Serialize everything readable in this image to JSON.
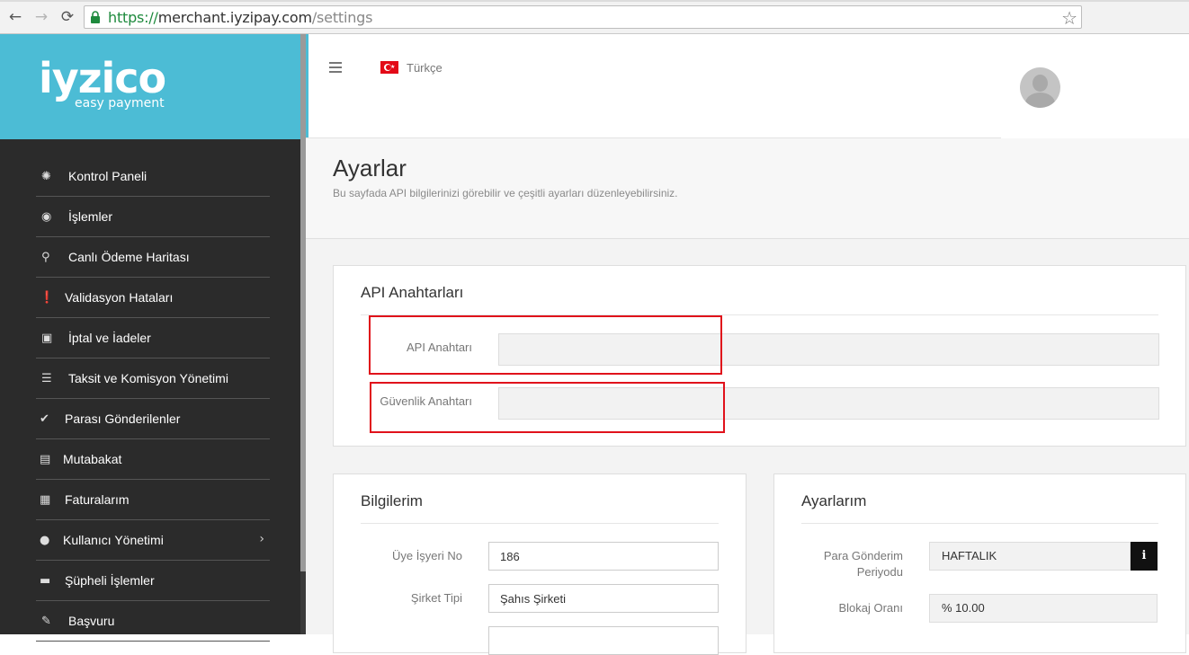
{
  "browser": {
    "url_scheme": "https://",
    "url_host": "merchant.iyzipay.com",
    "url_path": "/settings",
    "back_glyph": "←",
    "forward_glyph": "→",
    "reload_glyph": "⟳",
    "star_glyph": "☆"
  },
  "brand": {
    "name": "iyzico",
    "tagline": "easy payment",
    "accent_color": "#4cbcd5"
  },
  "sidebar": {
    "items": [
      {
        "label": "Kontrol Paneli",
        "icon": "dashboard-icon",
        "glyph": "✺"
      },
      {
        "label": "İşlemler",
        "icon": "eye-icon",
        "glyph": "◉"
      },
      {
        "label": "Canlı Ödeme Haritası",
        "icon": "map-pin-icon",
        "glyph": "⚲"
      },
      {
        "label": "Validasyon Hataları",
        "icon": "alert-icon",
        "glyph": "❗"
      },
      {
        "label": "İptal ve İadeler",
        "icon": "wallet-icon",
        "glyph": "▣"
      },
      {
        "label": "Taksit ve Komisyon Yönetimi",
        "icon": "sliders-icon",
        "glyph": "☰"
      },
      {
        "label": "Parası Gönderilenler",
        "icon": "check-icon",
        "glyph": "✔"
      },
      {
        "label": "Mutabakat",
        "icon": "excel-file-icon",
        "glyph": "▤"
      },
      {
        "label": "Faturalarım",
        "icon": "briefcase-icon",
        "glyph": "▦"
      },
      {
        "label": "Kullanıcı Yönetimi",
        "icon": "user-icon",
        "glyph": "●",
        "chevron": "›"
      },
      {
        "label": "Şüpheli İşlemler",
        "icon": "truck-icon",
        "glyph": "▬"
      },
      {
        "label": "Başvuru",
        "icon": "pencil-icon",
        "glyph": "✎"
      }
    ]
  },
  "topbar": {
    "language": "Türkçe",
    "language_flag": "tr-flag-icon"
  },
  "page": {
    "title": "Ayarlar",
    "subtitle": "Bu sayfada API bilgilerinizi görebilir ve çeşitli ayarları düzenleyebilirsiniz."
  },
  "api_panel": {
    "title": "API Anahtarları",
    "api_key_label": "API Anahtarı",
    "api_key_value": "",
    "security_key_label": "Güvenlik Anahtarı",
    "security_key_value": ""
  },
  "info_panel": {
    "title": "Bilgilerim",
    "merchant_no_label": "Üye İşyeri No",
    "merchant_no_value": "186",
    "company_type_label": "Şirket Tipi",
    "company_type_value": "Şahıs Şirketi"
  },
  "settings_panel": {
    "title": "Ayarlarım",
    "payout_label_line1": "Para Gönderim",
    "payout_label_line2": "Periyodu",
    "payout_value": "HAFTALIK",
    "info_glyph": "i",
    "block_rate_label": "Blokaj Oranı",
    "block_rate_value": "% 10.00"
  },
  "highlight_color": "#e0121b"
}
